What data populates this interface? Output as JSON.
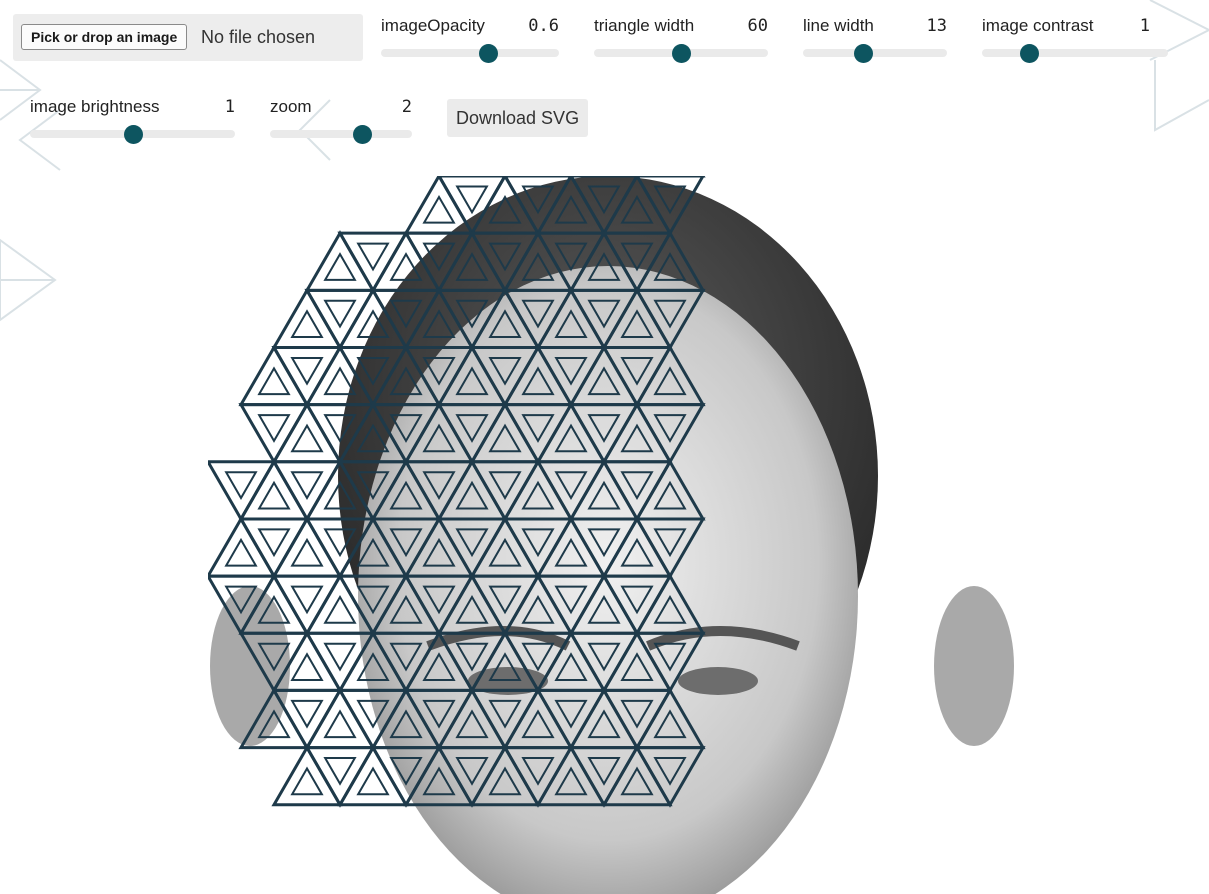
{
  "file_picker": {
    "button_label": "Pick or drop an image",
    "status": "No file chosen"
  },
  "sliders": [
    {
      "id": "image-opacity",
      "label": "imageOpacity",
      "value": "0.6",
      "position": 0.6
    },
    {
      "id": "triangle-width",
      "label": "triangle width",
      "value": "60",
      "position": 0.5
    },
    {
      "id": "line-width",
      "label": "line width",
      "value": "13",
      "position": 0.42
    },
    {
      "id": "image-contrast",
      "label": "image contrast",
      "value": "1",
      "position": 0.25
    },
    {
      "id": "image-brightness",
      "label": "image brightness",
      "value": "1",
      "position": 0.5
    },
    {
      "id": "zoom",
      "label": "zoom",
      "value": "2",
      "position": 0.65
    }
  ],
  "toolbar": {
    "download_label": "Download SVG"
  },
  "artwork": {
    "line_color": "#1e3a4a",
    "thumb_color": "#0d5560"
  }
}
